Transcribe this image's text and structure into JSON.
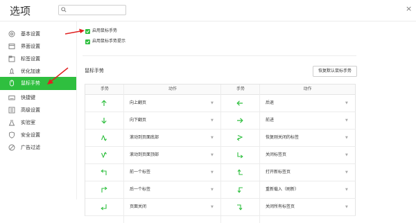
{
  "app": {
    "title": "选项",
    "close_glyph": "×"
  },
  "search": {
    "placeholder": "",
    "value": ""
  },
  "sidebar": {
    "items": [
      {
        "label": "基本设置",
        "icon": "circle-settings-icon",
        "active": false
      },
      {
        "label": "界面设置",
        "icon": "window-icon",
        "active": false
      },
      {
        "label": "标签设置",
        "icon": "tabs-icon",
        "active": false
      },
      {
        "label": "优化加速",
        "icon": "rocket-icon",
        "active": false
      },
      {
        "label": "鼠标手势",
        "icon": "mouse-icon",
        "active": true
      },
      {
        "label": "快捷键",
        "icon": "keyboard-icon",
        "active": false
      },
      {
        "label": "高级设置",
        "icon": "sliders-icon",
        "active": false
      },
      {
        "label": "实验室",
        "icon": "flask-icon",
        "active": false
      },
      {
        "label": "安全设置",
        "icon": "shield-icon",
        "active": false
      },
      {
        "label": "广告过滤",
        "icon": "block-icon",
        "active": false
      }
    ]
  },
  "options": {
    "enable_gesture": {
      "label": "启用鼠标手势",
      "checked": true
    },
    "enable_gesture_hint": {
      "label": "启用鼠标手势提示",
      "checked": true
    }
  },
  "gestures": {
    "section_title": "鼠标手势",
    "restore_button": "恢复默认鼠标手势",
    "headers": {
      "gesture": "手势",
      "action": "动作"
    },
    "rows": [
      {
        "left_icon": "arrow-up-icon",
        "left_action": "向上翻页",
        "right_icon": "arrow-left-icon",
        "right_action": "后退"
      },
      {
        "left_icon": "arrow-down-icon",
        "left_action": "向下翻页",
        "right_icon": "arrow-right-icon",
        "right_action": "前进"
      },
      {
        "left_icon": "gesture-up-down-icon",
        "left_action": "滚动到页面底部",
        "right_icon": "gesture-right-left-icon",
        "right_action": "恢复刚关闭的标签"
      },
      {
        "left_icon": "gesture-down-up-icon",
        "left_action": "滚动到页面顶部",
        "right_icon": "gesture-down-right-icon",
        "right_action": "关闭标签页"
      },
      {
        "left_icon": "gesture-up-left-icon",
        "left_action": "前一个标签",
        "right_icon": "gesture-left-up-icon",
        "right_action": "打开新标签页"
      },
      {
        "left_icon": "gesture-up-right-icon",
        "left_action": "后一个标签",
        "right_icon": "gesture-left-down-icon",
        "right_action": "重新载入（刷新）"
      },
      {
        "left_icon": "gesture-down-left-icon",
        "left_action": "页面关闭",
        "right_icon": "gesture-right-down-icon",
        "right_action": "关闭所有标签页"
      }
    ]
  },
  "colors": {
    "accent": "#2fbf3f",
    "arrow_annotation": "#e02020"
  }
}
